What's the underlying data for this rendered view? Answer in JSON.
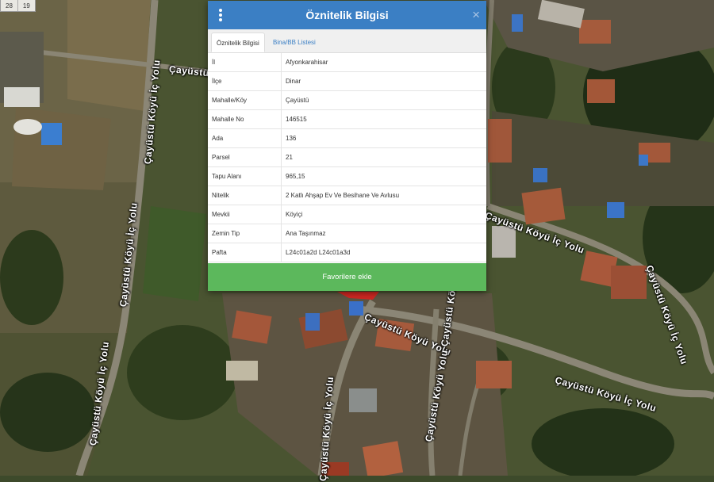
{
  "map": {
    "scale_labels": [
      "28",
      "19"
    ],
    "road_labels": [
      "Çayüstü Köyü İç Yolu",
      "Çayüstü Köyü İç Yolu",
      "Çayüstü Köyü İç Yolu",
      "Çayüstü Köyü İç Yolu",
      "Çayüstü Köyü İç Yolu",
      "Çayüstü Köyü İç Yolu",
      "Çayüstü Köyü İç Yolu",
      "Çayüstü Köyü Yolu",
      "Çayüstü Köyü Yolu",
      "Çayüstü Köyü İç Yolu",
      "Çayüstü Köyü Yolu"
    ]
  },
  "dialog": {
    "title": "Öznitelik Bilgisi",
    "close_label": "×",
    "menu_icon": "vertical-dots-icon",
    "tabs": [
      {
        "label": "Öznitelik Bilgisi",
        "active": true
      },
      {
        "label": "Bina/BB Listesi",
        "active": false
      }
    ],
    "rows": [
      {
        "key": "İl",
        "value": "Afyonkarahisar"
      },
      {
        "key": "İlçe",
        "value": "Dinar"
      },
      {
        "key": "Mahalle/Köy",
        "value": "Çayüstü"
      },
      {
        "key": "Mahalle No",
        "value": "146515"
      },
      {
        "key": "Ada",
        "value": "136"
      },
      {
        "key": "Parsel",
        "value": "21"
      },
      {
        "key": "Tapu Alanı",
        "value": "965,15"
      },
      {
        "key": "Nitelik",
        "value": "2 Katlı Ahşap Ev Ve Besihane Ve Avlusu"
      },
      {
        "key": "Mevkii",
        "value": "Köyiçi"
      },
      {
        "key": "Zemin Tip",
        "value": "Ana Taşınmaz"
      },
      {
        "key": "Pafta",
        "value": "L24c01a2d L24c01a3d"
      }
    ],
    "favorite_button": "Favorilere ekle"
  },
  "colors": {
    "header": "#3b7fc4",
    "favorite_button": "#5cb85c",
    "parcel_highlight": "#e0201c"
  }
}
